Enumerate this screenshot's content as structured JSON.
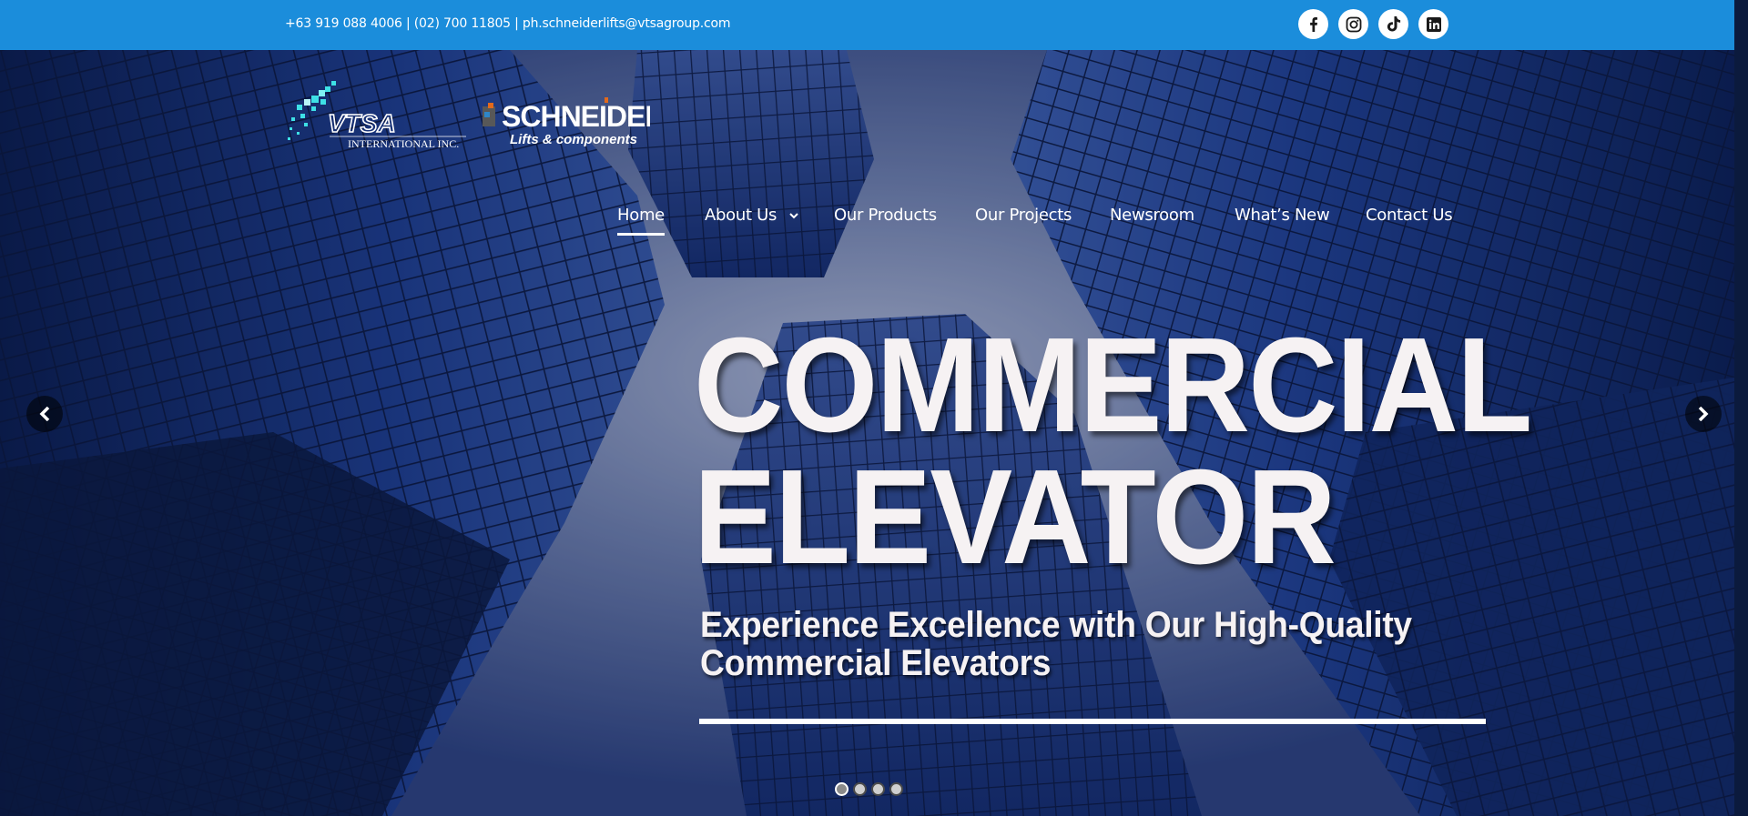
{
  "topbar": {
    "contact": "+63 919 088 4006 | (02) 700 11805  |  ph.schneiderlifts@vtsagroup.com",
    "social": [
      {
        "icon": "facebook-icon",
        "label": "f"
      },
      {
        "icon": "instagram-icon"
      },
      {
        "icon": "tiktok-icon"
      },
      {
        "icon": "linkedin-icon",
        "label": "in"
      }
    ],
    "color": "#1b8ddb"
  },
  "logos": {
    "vtsa": {
      "name": "VTSA",
      "sub": "INTERNATIONAL INC."
    },
    "schneider": {
      "name": "SCHNEIDER",
      "sub": "Lifts & components"
    }
  },
  "nav": {
    "items": [
      {
        "label": "Home",
        "active": true
      },
      {
        "label": "About Us",
        "dropdown": true
      },
      {
        "label": "Our Products"
      },
      {
        "label": "Our Projects"
      },
      {
        "label": "Newsroom"
      },
      {
        "label": "What’s New"
      },
      {
        "label": "Contact Us"
      }
    ]
  },
  "hero": {
    "headline_line1": "COMMERCIAL",
    "headline_line2": "ELEVATOR",
    "subheadline_line1": "Experience Excellence with Our High-Quality",
    "subheadline_line2": "Commercial Elevators",
    "slides_count": 4,
    "active_slide": 1
  }
}
